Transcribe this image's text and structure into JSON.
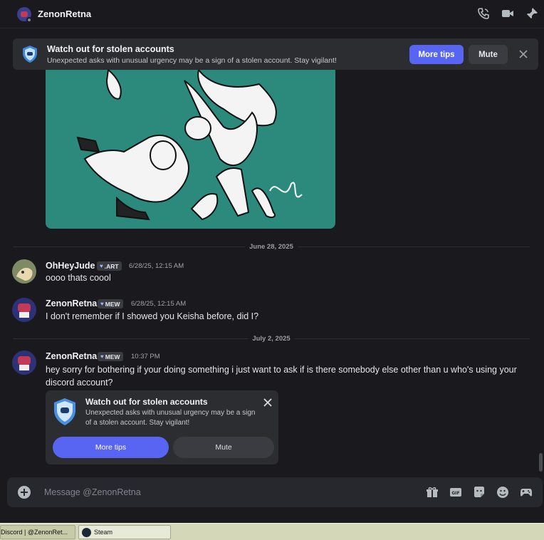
{
  "header": {
    "title": "ZenonRetna",
    "icons": [
      "phone-call-icon",
      "video-call-icon",
      "pin-icon"
    ]
  },
  "banner": {
    "title": "Watch out for stolen accounts",
    "description": "Unexpected asks with unusual urgency may be a sign of a stolen account. Stay vigilant!",
    "more_label": "More tips",
    "mute_label": "Mute"
  },
  "dividers": [
    {
      "label": "June 28, 2025"
    },
    {
      "label": "July 2, 2025"
    }
  ],
  "messages": [
    {
      "author": "OhHeyJude",
      "tag": ".ART",
      "time": "6/28/25, 12:15 AM",
      "text": "oooo thats coool"
    },
    {
      "author": "ZenonRetna",
      "tag": "MEW",
      "time": "6/28/25, 12:15 AM",
      "text": "I don't remember if I showed you Keisha before, did I?"
    },
    {
      "author": "ZenonRetna",
      "tag": "MEW",
      "time": "10:37 PM",
      "text": "hey sorry for bothering if your doing something i just want to ask if is there somebody else other than u who's using your discord account?"
    }
  ],
  "card": {
    "title": "Watch out for stolen accounts",
    "description": "Unexpected asks with unusual urgency may be a sign of a stolen account. Stay vigilant!",
    "more_label": "More tips",
    "mute_label": "Mute"
  },
  "composer": {
    "placeholder": "Message @ZenonRetna",
    "tools": [
      "gift-icon",
      "gif-icon",
      "sticker-icon",
      "emoji-icon",
      "activities-icon"
    ]
  },
  "taskbar": {
    "items": [
      {
        "label": "Discord | @ZenonRet..."
      },
      {
        "label": "Steam"
      }
    ]
  },
  "colors": {
    "accent": "#5865f2",
    "background": "#1a1a1e",
    "attachment_bg": "#2b8a7c"
  }
}
